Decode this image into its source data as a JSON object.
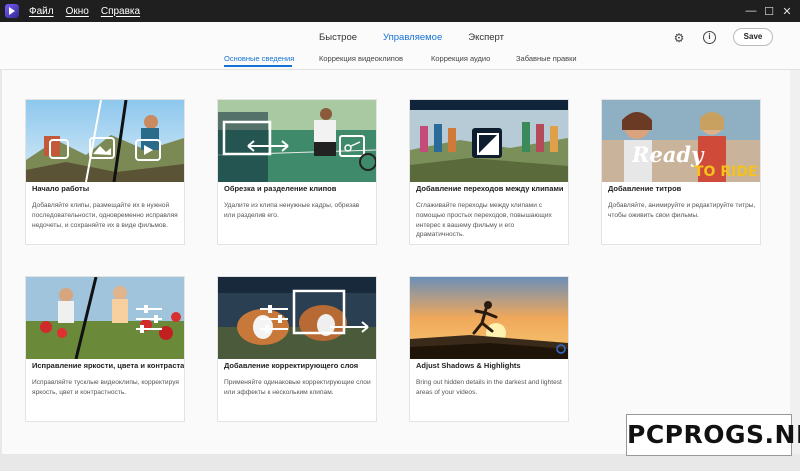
{
  "menu": [
    "Файл",
    "Окно",
    "Справка"
  ],
  "window_controls": {
    "minimize": "—",
    "maximize": "☐",
    "close": "✕"
  },
  "modes": {
    "quick": "Быстрое",
    "guided": "Управляемое",
    "expert": "Эксперт",
    "active": "Управляемое"
  },
  "header": {
    "save_label": "Save",
    "accent": "#1673d4"
  },
  "subtabs": [
    "Основные сведения",
    "Коррекция видеоклипов",
    "Коррекция аудио",
    "Забавные правки"
  ],
  "cards": [
    {
      "title": "Начало работы",
      "desc": "Добавляйте клипы, размещайте их в нужной последовательности, одновременно исправляя недочеты, и сохраняйте их в виде фильмов."
    },
    {
      "title": "Обрезка и разделение клипов",
      "desc": "Удалите из клипа ненужные кадры, обрезав или разделив его."
    },
    {
      "title": "Добавление переходов между клипами",
      "desc": "Сглаживайте переходы между клипами с помощью простых переходов, повышающих интерес к вашему фильму и его драматичность."
    },
    {
      "title": "Добавление титров",
      "desc": "Добавляйте, анимируйте и редактируйте титры, чтобы оживить свои фильмы.",
      "thumb_text": [
        "Ready",
        "TO RIDE!"
      ]
    },
    {
      "title": "Исправление яркости, цвета и контраста",
      "desc": "Исправляйте тусклые видеоклипы, корректируя яркость, цвет и контрастность."
    },
    {
      "title": "Добавление корректирующего слоя",
      "desc": "Применяйте одинаковые корректирующие слои или эффекты к нескольким клипам."
    },
    {
      "title": "Adjust Shadows & Highlights",
      "desc": "Bring out hidden details in the darkest and lightest areas of your videos."
    }
  ],
  "watermark": "PCPROGS.NET"
}
